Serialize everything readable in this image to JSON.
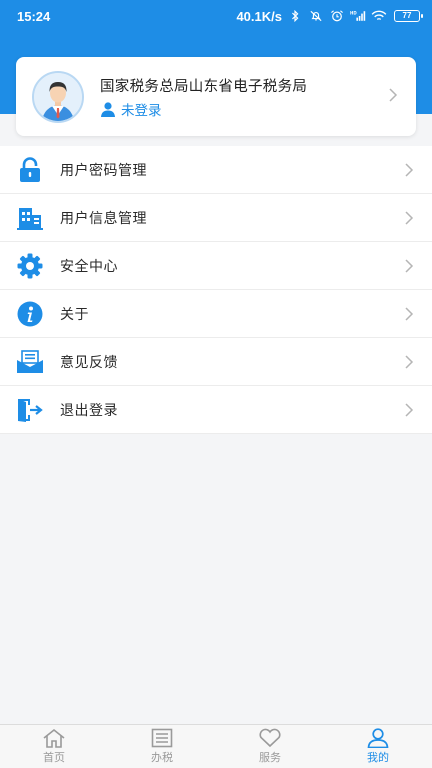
{
  "status_bar": {
    "time": "15:24",
    "network_speed": "40.1K/s",
    "battery": "77",
    "icons": [
      "bluetooth-icon",
      "mute-icon",
      "alarm-icon",
      "hd-signal-icon",
      "wifi-icon",
      "battery-icon"
    ]
  },
  "profile": {
    "org_name": "国家税务总局山东省电子税务局",
    "login_status": "未登录",
    "avatar": "avatar-icon"
  },
  "menu": {
    "items": [
      {
        "label": "用户密码管理",
        "icon": "lock-icon"
      },
      {
        "label": "用户信息管理",
        "icon": "building-icon"
      },
      {
        "label": "安全中心",
        "icon": "gear-icon"
      },
      {
        "label": "关于",
        "icon": "info-icon"
      },
      {
        "label": "意见反馈",
        "icon": "feedback-icon"
      },
      {
        "label": "退出登录",
        "icon": "logout-icon"
      }
    ]
  },
  "bottom_nav": {
    "items": [
      {
        "label": "首页",
        "icon": "home-icon",
        "active": false
      },
      {
        "label": "办税",
        "icon": "list-icon",
        "active": false
      },
      {
        "label": "服务",
        "icon": "heart-icon",
        "active": false
      },
      {
        "label": "我的",
        "icon": "user-icon",
        "active": true
      }
    ]
  },
  "colors": {
    "primary": "#1e8de6",
    "background": "#f4f5f7",
    "text": "#2a2a2a",
    "inactive": "#9a9a9a"
  }
}
